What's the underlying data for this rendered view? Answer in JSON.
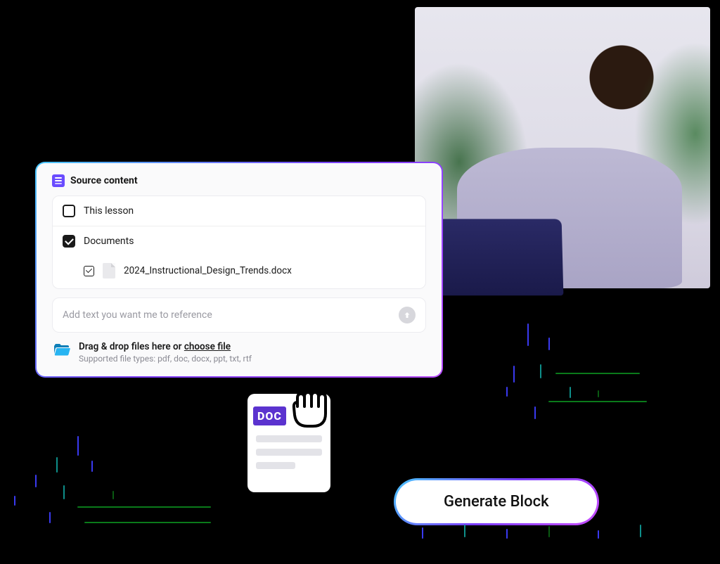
{
  "panel": {
    "title": "Source content",
    "options": {
      "this_lesson": "This lesson",
      "documents": "Documents"
    },
    "file_name": "2024_Instructional_Design_Trends.docx",
    "reference_placeholder": "Add text you want me to reference",
    "dropzone": {
      "prefix": "Drag & drop files here or ",
      "choose": "choose file",
      "supported": "Supported file types: pdf, doc, docx, ppt, txt, rtf"
    }
  },
  "doc_badge": "DOC",
  "generate_label": "Generate Block"
}
